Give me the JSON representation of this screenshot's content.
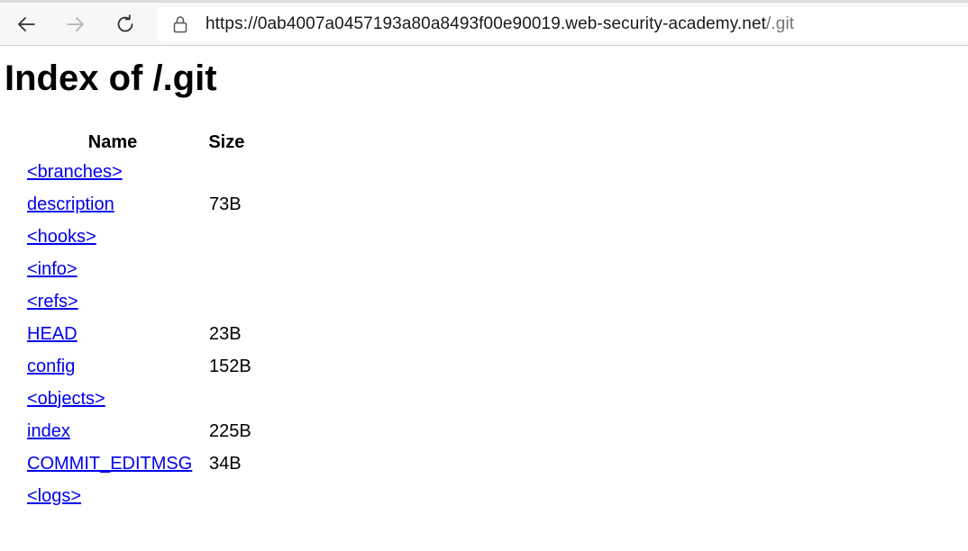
{
  "browser": {
    "url_host": "https://0ab4007a0457193a80a8493f00e90019.web-security-academy.net",
    "url_path": "/.git",
    "icons": {
      "back": "back-arrow-icon",
      "forward": "forward-arrow-icon",
      "reload": "reload-icon",
      "lock": "lock-icon"
    }
  },
  "page": {
    "title": "Index of /.git",
    "columns": {
      "name": "Name",
      "size": "Size"
    },
    "rows": [
      {
        "name": "<branches>",
        "size": ""
      },
      {
        "name": "description",
        "size": "73B"
      },
      {
        "name": "<hooks>",
        "size": ""
      },
      {
        "name": "<info>",
        "size": ""
      },
      {
        "name": "<refs>",
        "size": ""
      },
      {
        "name": "HEAD",
        "size": "23B"
      },
      {
        "name": "config",
        "size": "152B"
      },
      {
        "name": "<objects>",
        "size": ""
      },
      {
        "name": "index",
        "size": "225B"
      },
      {
        "name": "COMMIT_EDITMSG",
        "size": "34B"
      },
      {
        "name": "<logs>",
        "size": ""
      }
    ]
  },
  "colors": {
    "link": "#0000ee",
    "toolbar_bg": "#f7f7f7",
    "url_path": "#757575"
  }
}
